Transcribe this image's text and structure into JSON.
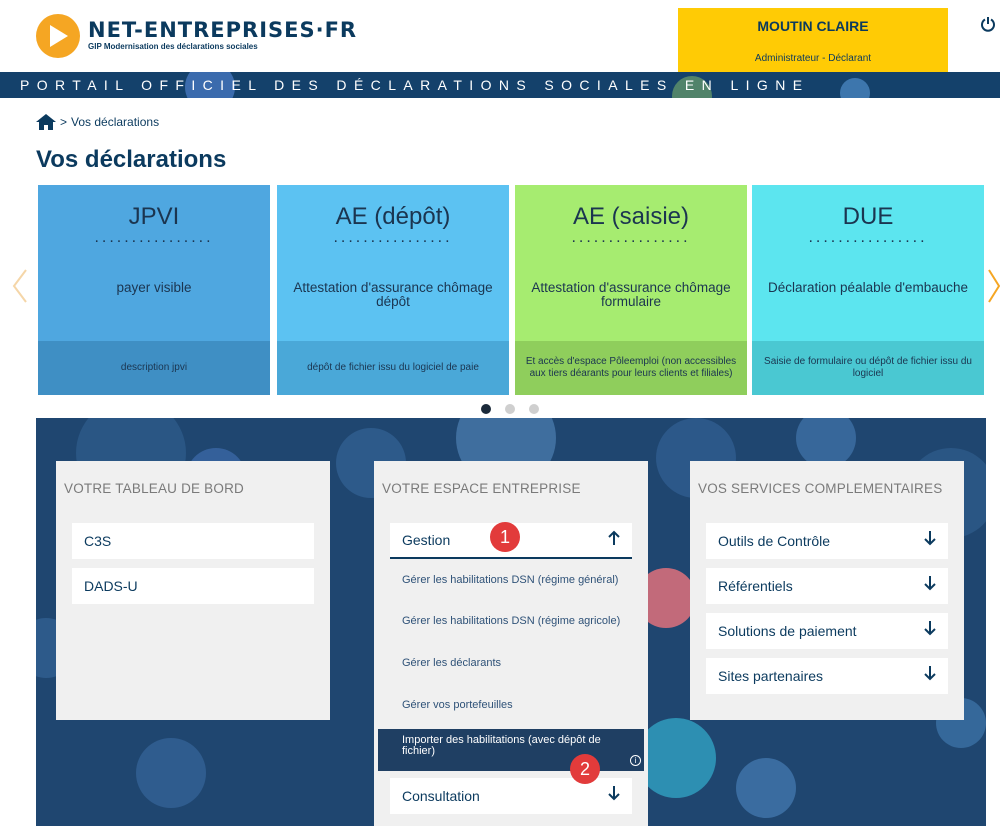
{
  "header": {
    "logo_title": "NET-ENTREPRISES·FR",
    "logo_subtitle": "GIP Modernisation des déclarations sociales",
    "user_name": "MOUTIN CLAIRE",
    "user_role": "Administrateur - Déclarant",
    "power_icon": "power-icon"
  },
  "band": {
    "text": "PORTAIL OFFICIEL DES DÉCLARATIONS SOCIALES EN LIGNE"
  },
  "breadcrumb": {
    "separator": ">",
    "current": "Vos déclarations"
  },
  "page_title": "Vos déclarations",
  "carousel": {
    "prev_icon": "chevron-left-icon",
    "next_icon": "chevron-right-icon",
    "cards": [
      {
        "title": "JPVI",
        "dots": "................",
        "desc": "payer visible",
        "footer": "description jpvi",
        "color": "#4fa7e0",
        "footer_color": "#3f8fc4"
      },
      {
        "title": "AE (dépôt)",
        "dots": "................",
        "desc": "Attestation d'assurance chômage dépôt",
        "footer": "dépôt de fichier issu du logiciel de paie",
        "color": "#5cc2f2",
        "footer_color": "#4aa8d8"
      },
      {
        "title": "AE (saisie)",
        "dots": "................",
        "desc": "Attestation d'assurance chômage formulaire",
        "footer": "Et accès d'espace Pôleemploi (non accessibles aux tiers déarants pour leurs clients et filiales)",
        "color": "#a6ec70",
        "footer_color": "#8fce5c"
      },
      {
        "title": "DUE",
        "dots": "................",
        "desc": "Déclaration péalable d'embauche",
        "footer": "Saisie de formulaire ou dépôt de fichier issu du logiciel",
        "color": "#5ce5ef",
        "footer_color": "#4ac8d2"
      }
    ],
    "pages": 3,
    "active_page": 0
  },
  "columns": {
    "tableau": {
      "title": "VOTRE TABLEAU DE BORD",
      "items": [
        "C3S",
        "DADS-U"
      ]
    },
    "espace": {
      "title": "VOTRE ESPACE ENTREPRISE",
      "gestion": {
        "label": "Gestion",
        "icon": "arrow-up-icon"
      },
      "sub_items": [
        "Gérer les habilitations DSN (régime général)",
        "Gérer les habilitations DSN (régime agricole)",
        "Gérer les déclarants",
        "Gérer vos portefeuilles"
      ],
      "highlighted": "Importer des habilitations (avec dépôt de fichier)",
      "consultation": {
        "label": "Consultation",
        "icon": "arrow-down-icon"
      }
    },
    "services": {
      "title": "VOS SERVICES COMPLEMENTAIRES",
      "items": [
        "Outils de Contrôle",
        "Référentiels",
        "Solutions de paiement",
        "Sites partenaires"
      ]
    }
  },
  "badges": [
    "1",
    "2"
  ],
  "colors": {
    "navy": "#0b3a5e",
    "yellow": "#ffcb05",
    "orange": "#f5a623",
    "panel": "#1f4670",
    "badge": "#e23b3b"
  }
}
